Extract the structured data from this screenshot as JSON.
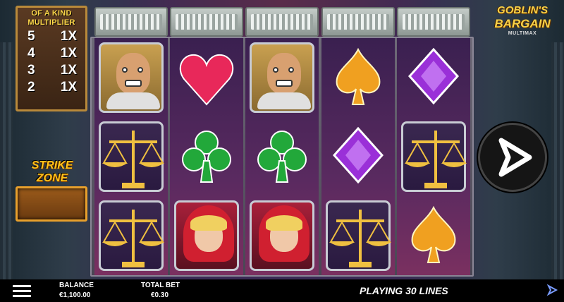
{
  "logo": {
    "line1": "GOBLIN'S",
    "line2": "BARGAIN",
    "line3": "MULTIMAX"
  },
  "multiplier": {
    "title_line1": "OF A KIND",
    "title_line2": "MULTIPLIER",
    "rows": [
      {
        "kind": "5",
        "mult": "1X"
      },
      {
        "kind": "4",
        "mult": "1X"
      },
      {
        "kind": "3",
        "mult": "1X"
      },
      {
        "kind": "2",
        "mult": "1X"
      }
    ]
  },
  "strike_zone": {
    "label": "STRIKE ZONE"
  },
  "reels": [
    [
      "goblin",
      "scale",
      "scale"
    ],
    [
      "heart",
      "club",
      "girl"
    ],
    [
      "goblin",
      "club",
      "girl"
    ],
    [
      "spade",
      "diamond",
      "scale"
    ],
    [
      "diamond",
      "scale",
      "spade"
    ]
  ],
  "colors": {
    "heart": "#e8285a",
    "club": "#22a83a",
    "spade": "#f0a020",
    "diamond": "#9a30d8",
    "accent": "#ffc21a"
  },
  "bottom_bar": {
    "balance_label": "BALANCE",
    "balance_value": "€1,100.00",
    "total_bet_label": "TOTAL BET",
    "total_bet_value": "€0.30",
    "lines_text": "PLAYING 30 LINES"
  },
  "icons": {
    "menu": "hamburger-menu-icon",
    "spin": "spin-play-icon",
    "brand": "brand-logo-icon"
  }
}
